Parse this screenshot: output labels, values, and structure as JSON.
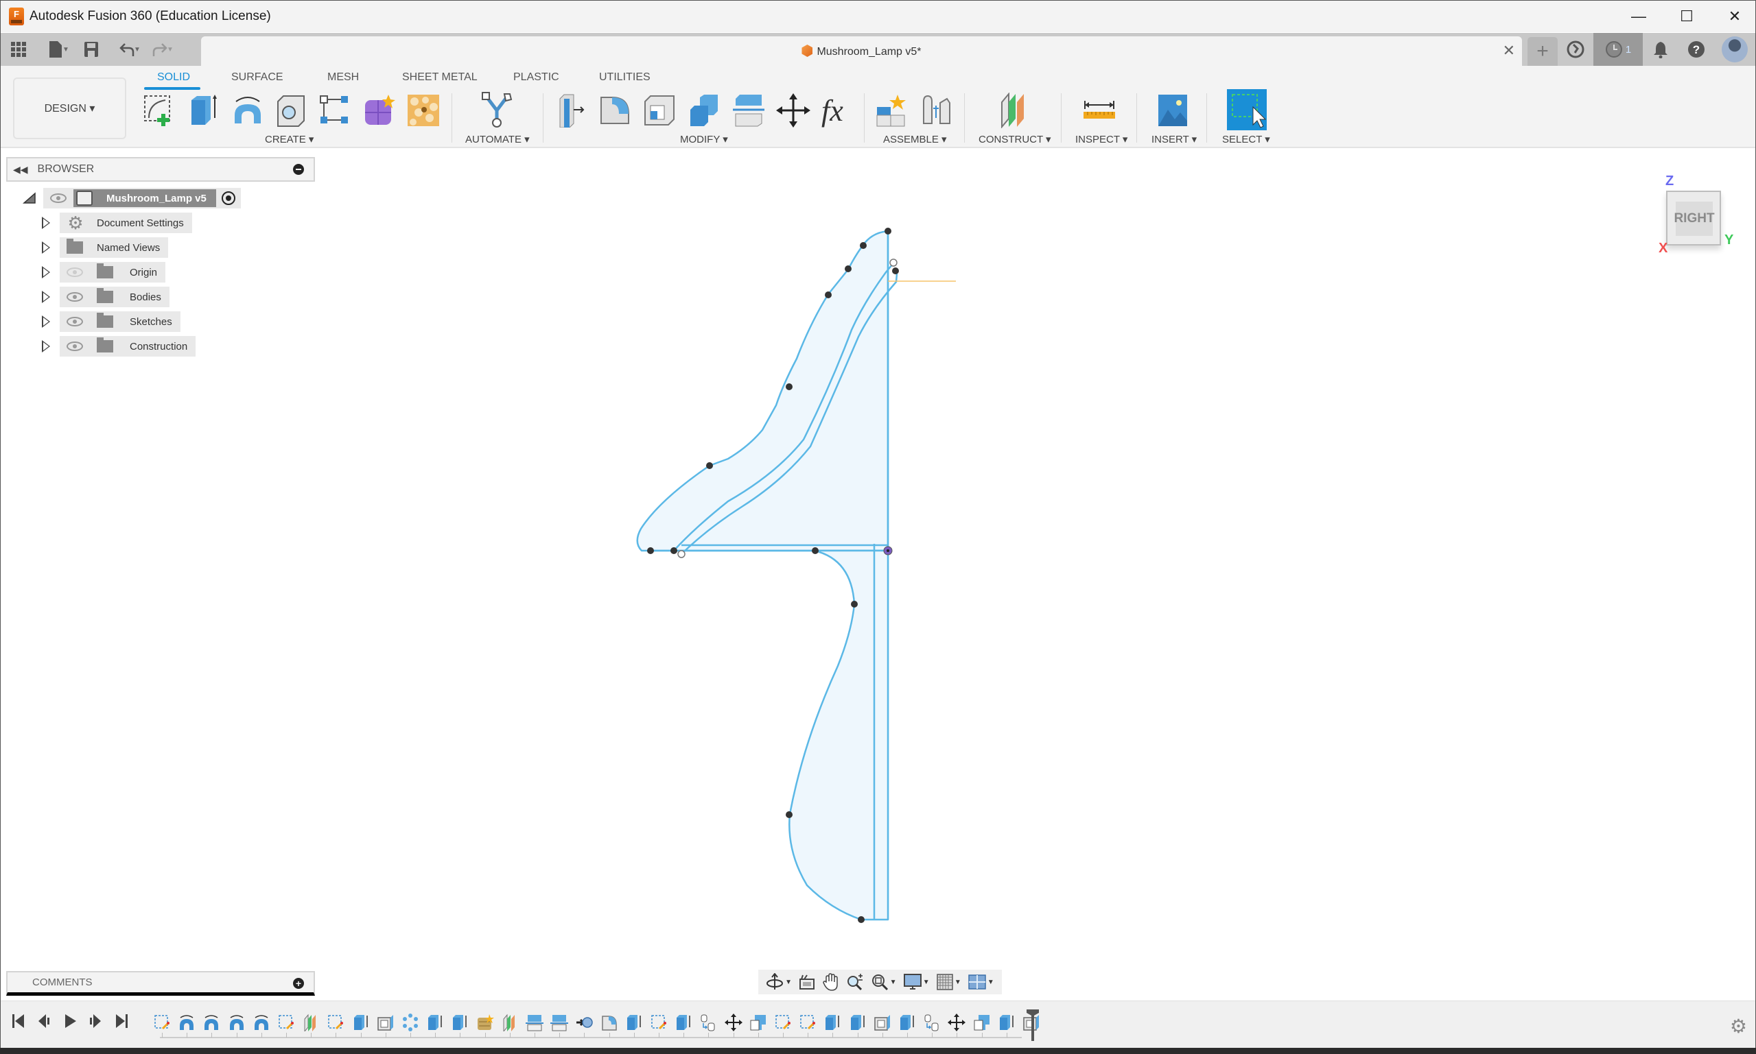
{
  "window": {
    "title": "Autodesk Fusion 360 (Education License)",
    "controls": {
      "minimize": "—",
      "maximize": "☐",
      "close": "✕"
    }
  },
  "quick_access": {
    "grid_icon": "apps-grid-icon",
    "file_icon": "file-icon",
    "save_icon": "save-icon",
    "undo_icon": "undo-icon",
    "redo_icon": "redo-icon"
  },
  "document_tab": {
    "label": "Mushroom_Lamp v5*",
    "close": "✕"
  },
  "header_right": {
    "new_tab": "+",
    "job_status_count": "1"
  },
  "workspace": {
    "selector_label": "DESIGN ▾",
    "tabs": [
      {
        "label": "SOLID",
        "active": true
      },
      {
        "label": "SURFACE",
        "active": false
      },
      {
        "label": "MESH",
        "active": false
      },
      {
        "label": "SHEET METAL",
        "active": false
      },
      {
        "label": "PLASTIC",
        "active": false
      },
      {
        "label": "UTILITIES",
        "active": false
      }
    ],
    "groups": [
      {
        "label": "CREATE ▾"
      },
      {
        "label": "AUTOMATE ▾"
      },
      {
        "label": "MODIFY ▾"
      },
      {
        "label": "ASSEMBLE ▾"
      },
      {
        "label": "CONSTRUCT ▾"
      },
      {
        "label": "INSPECT ▾"
      },
      {
        "label": "INSERT ▾"
      },
      {
        "label": "SELECT ▾"
      }
    ]
  },
  "browser": {
    "title": "BROWSER",
    "root": {
      "label": "Mushroom_Lamp v5"
    },
    "items": [
      {
        "label": "Document Settings",
        "icon": "gear",
        "visible": null
      },
      {
        "label": "Named Views",
        "icon": "folder",
        "visible": null
      },
      {
        "label": "Origin",
        "icon": "folder",
        "visible": false
      },
      {
        "label": "Bodies",
        "icon": "folder",
        "visible": true
      },
      {
        "label": "Sketches",
        "icon": "folder",
        "visible": true
      },
      {
        "label": "Construction",
        "icon": "folder",
        "visible": true
      }
    ]
  },
  "viewcube": {
    "face": "RIGHT",
    "axes": {
      "z": "Z",
      "y": "Y",
      "x": "X"
    },
    "colors": {
      "z": "#6a6af0",
      "y": "#3ec95a",
      "x": "#f05050"
    }
  },
  "sketch": {
    "line_color": "#5bb8e6",
    "fill_color": "#eef7fd",
    "point_color": "#333333",
    "origin_point_color": "#7a5cc0",
    "guide_color": "#f5c36a"
  },
  "comments": {
    "label": "COMMENTS"
  },
  "navbar": {
    "tools": [
      "orbit",
      "look-at",
      "pan",
      "zoom",
      "fit",
      "display-settings",
      "grid-settings",
      "viewports"
    ]
  },
  "timeline": {
    "controls": [
      "first",
      "previous",
      "play",
      "next",
      "last"
    ],
    "features": [
      "sketch",
      "revolve",
      "revolve",
      "revolve",
      "revolve",
      "sketch",
      "plane",
      "sketch",
      "extrude",
      "shell",
      "pattern",
      "extrude",
      "extrude",
      "form",
      "plane",
      "split",
      "split",
      "joint",
      "fillet",
      "extrude",
      "sketch",
      "extrude",
      "align",
      "move",
      "combine",
      "sketch",
      "sketch",
      "extrude",
      "extrude",
      "shell",
      "extrude",
      "align",
      "move",
      "combine",
      "extrude",
      "shell"
    ]
  }
}
